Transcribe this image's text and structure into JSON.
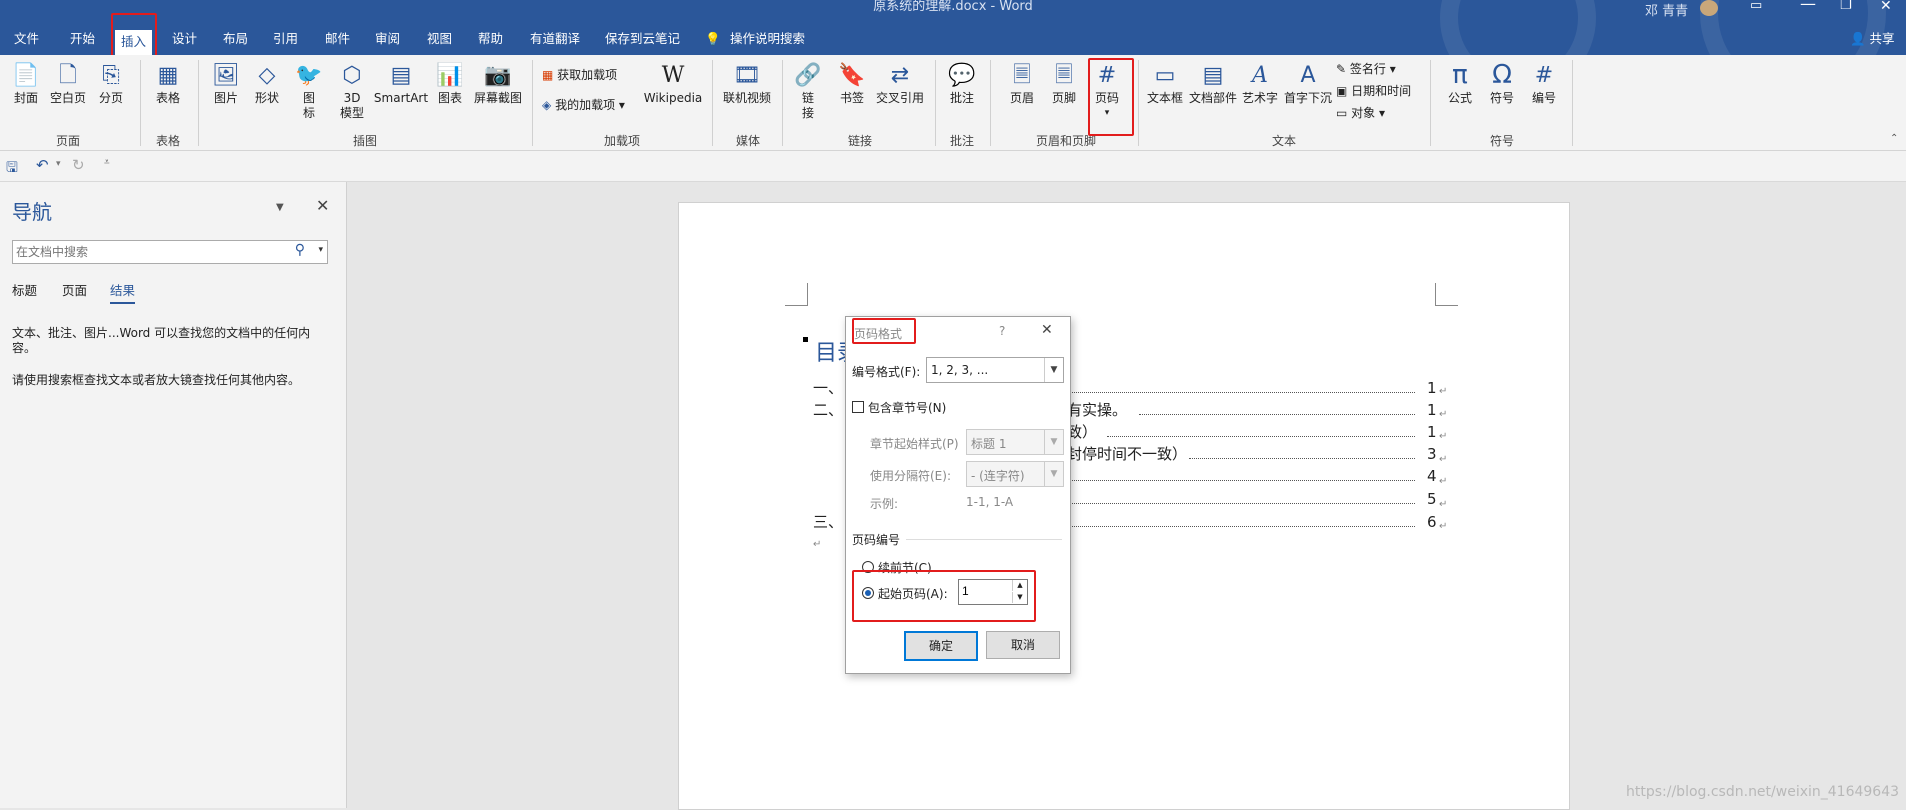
{
  "window": {
    "title": "原系统的理解.docx  -  Word",
    "user": "邓 青青",
    "share": "共享"
  },
  "tabs": [
    "文件",
    "开始",
    "插入",
    "设计",
    "布局",
    "引用",
    "邮件",
    "审阅",
    "视图",
    "帮助",
    "有道翻译",
    "保存到云笔记",
    "操作说明搜索"
  ],
  "active_tab": "插入",
  "ribbon": {
    "pages_group": {
      "label": "页面",
      "items": [
        "封面",
        "空白页",
        "分页"
      ]
    },
    "table_group": {
      "label": "表格",
      "items": [
        "表格"
      ]
    },
    "illus_group": {
      "label": "插图",
      "items": [
        "图片",
        "形状",
        "图\n标",
        "3D\n模型",
        "SmartArt",
        "图表",
        "屏幕截图"
      ]
    },
    "addins_group": {
      "label": "加载项",
      "items": [
        "获取加载项",
        "我的加载项",
        "Wikipedia"
      ]
    },
    "media_group": {
      "label": "媒体",
      "items": [
        "联机视频"
      ]
    },
    "links_group": {
      "label": "链接",
      "items": [
        "链\n接",
        "书签",
        "交叉引用"
      ]
    },
    "comment_group": {
      "label": "批注",
      "items": [
        "批注"
      ]
    },
    "hf_group": {
      "label": "页眉和页脚",
      "items": [
        "页眉",
        "页脚",
        "页码"
      ]
    },
    "text_group": {
      "label": "文本",
      "items": [
        "文本框",
        "文档部件",
        "艺术字",
        "首字下沉"
      ],
      "small": [
        "签名行",
        "日期和时间",
        "对象"
      ]
    },
    "symbol_group": {
      "label": "符号",
      "items": [
        "公式",
        "符号",
        "编号"
      ]
    }
  },
  "nav": {
    "title": "导航",
    "search_placeholder": "在文档中搜索",
    "tabs": [
      "标题",
      "页面",
      "结果"
    ],
    "active_tab": "结果",
    "msg1": "文本、批注、图片...Word 可以查找您的文档中的任何内容。",
    "msg2": "请使用搜索框查找文本或者放大镜查找任何其他内容。"
  },
  "document": {
    "heading": "目录",
    "entries": [
      {
        "left": "一、",
        "right": "",
        "page": "1"
      },
      {
        "left": "二、",
        "right": "有实操。",
        "page": "1"
      },
      {
        "left": "",
        "right": "致）",
        "page": "1"
      },
      {
        "left": "",
        "right": "封停时间不一致）",
        "page": "3"
      },
      {
        "left": "",
        "right": "",
        "page": "4"
      },
      {
        "left": "",
        "right": "",
        "page": "5"
      },
      {
        "left": "三、",
        "right": "",
        "page": "6"
      }
    ]
  },
  "dialog": {
    "title": "页码格式",
    "help": "?",
    "format_label": "编号格式(F):",
    "format_value": "1, 2, 3, ...",
    "include_chapter": "包含章节号(N)",
    "chapter_style_label": "章节起始样式(P)",
    "chapter_style_value": "标题 1",
    "separator_label": "使用分隔符(E):",
    "separator_value": "-  (连字符)",
    "example_label": "示例:",
    "example_value": "1-1, 1-A",
    "numbering_section": "页码编号",
    "continue_label": "续前节(C)",
    "start_label": "起始页码(A):",
    "start_value": "1",
    "ok": "确定",
    "cancel": "取消"
  },
  "watermark": "https://blog.csdn.net/weixin_41649643",
  "colors": {
    "brand": "#2b579a",
    "highlight": "#e21c1c"
  }
}
